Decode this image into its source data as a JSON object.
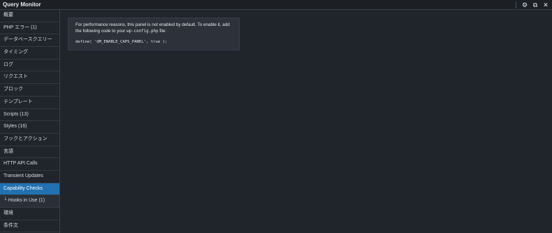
{
  "window": {
    "title": "Query Monitor"
  },
  "title_controls": {
    "settings_icon": "gear-icon",
    "popout_icon": "popout-icon",
    "close_icon": "close-icon",
    "settings_glyph": "⚙",
    "popout_glyph": "⧉",
    "close_glyph": "✕"
  },
  "sidebar": {
    "items": [
      {
        "label": "概要"
      },
      {
        "label": "PHP エラー (1)"
      },
      {
        "label": "データベースクエリー"
      },
      {
        "label": "タイミング"
      },
      {
        "label": "ログ"
      },
      {
        "label": "リクエスト"
      },
      {
        "label": "ブロック"
      },
      {
        "label": "テンプレート"
      },
      {
        "label": "Scripts (13)"
      },
      {
        "label": "Styles (16)"
      },
      {
        "label": "フックとアクション"
      },
      {
        "label": "言語"
      },
      {
        "label": "HTTP API Calls"
      },
      {
        "label": "Transient Updates"
      },
      {
        "label": "Capability Checks",
        "active": true
      },
      {
        "label": "└ Hooks in Use (1)",
        "sub": true
      },
      {
        "label": "環境"
      },
      {
        "label": "条件文"
      }
    ]
  },
  "panel": {
    "notice_before": "For performance reasons, this panel is not enabled by default. To enable it, add the following code to your ",
    "notice_file": "wp-config.php",
    "notice_after": " file:",
    "code": "define( 'QM_ENABLE_CAPS_PANEL', true );"
  },
  "colors": {
    "background": "#20242b",
    "active": "#2271b1",
    "notice_bg": "#2c313a"
  }
}
